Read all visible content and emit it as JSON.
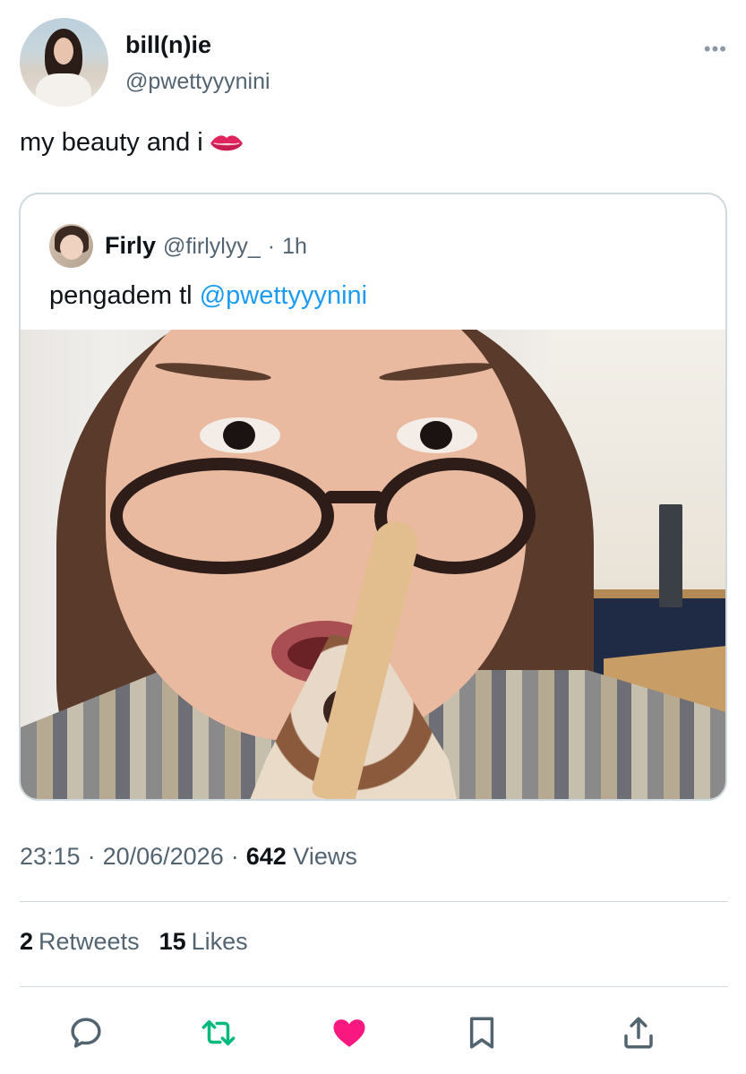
{
  "author": {
    "display_name": "bill(n)ie",
    "handle": "@pwettyyynini"
  },
  "tweet": {
    "text": "my beauty and i",
    "emoji_icon": "lips-icon"
  },
  "quoted": {
    "display_name": "Firly",
    "handle": "@firlylyy_",
    "separator": "·",
    "time": "1h",
    "text_prefix": "pengadem tl",
    "mention": "@pwettyyynini"
  },
  "meta": {
    "time": "23:15",
    "sep1": "·",
    "date": "20/06/2026",
    "sep2": "·",
    "views_count": "642",
    "views_label": "Views"
  },
  "stats": {
    "retweets_count": "2",
    "retweets_label": "Retweets",
    "likes_count": "15",
    "likes_label": "Likes"
  },
  "actions": {
    "reply_icon": "reply-icon",
    "retweet_icon": "retweet-icon",
    "like_icon": "heart-icon",
    "bookmark_icon": "bookmark-icon",
    "share_icon": "share-icon"
  },
  "colors": {
    "retweet_active": "#00ba7c",
    "like_active": "#f91880",
    "mention": "#1d9bf0",
    "secondary_text": "#536471"
  }
}
